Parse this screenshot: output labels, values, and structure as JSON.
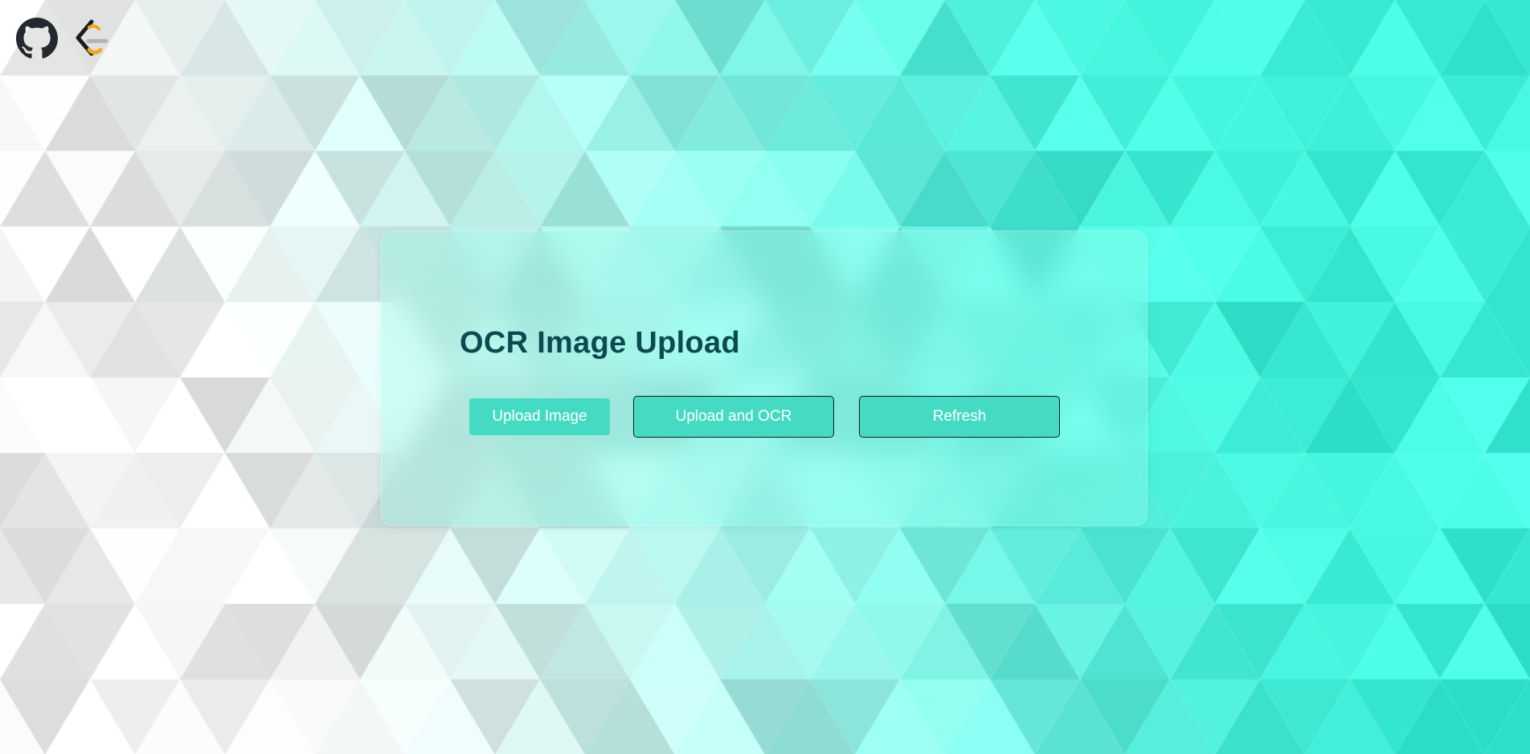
{
  "app": {
    "title": "OCR Image Upload"
  },
  "header": {
    "icons": [
      {
        "name": "github-icon"
      },
      {
        "name": "leetcode-icon"
      }
    ]
  },
  "actions": {
    "upload_image_label": "Upload Image",
    "upload_ocr_label": "Upload and OCR",
    "refresh_label": "Refresh"
  },
  "colors": {
    "button_bg": "#45dbc3",
    "title_color": "#0d4a4f",
    "accent_teal": "#40f0d8"
  }
}
